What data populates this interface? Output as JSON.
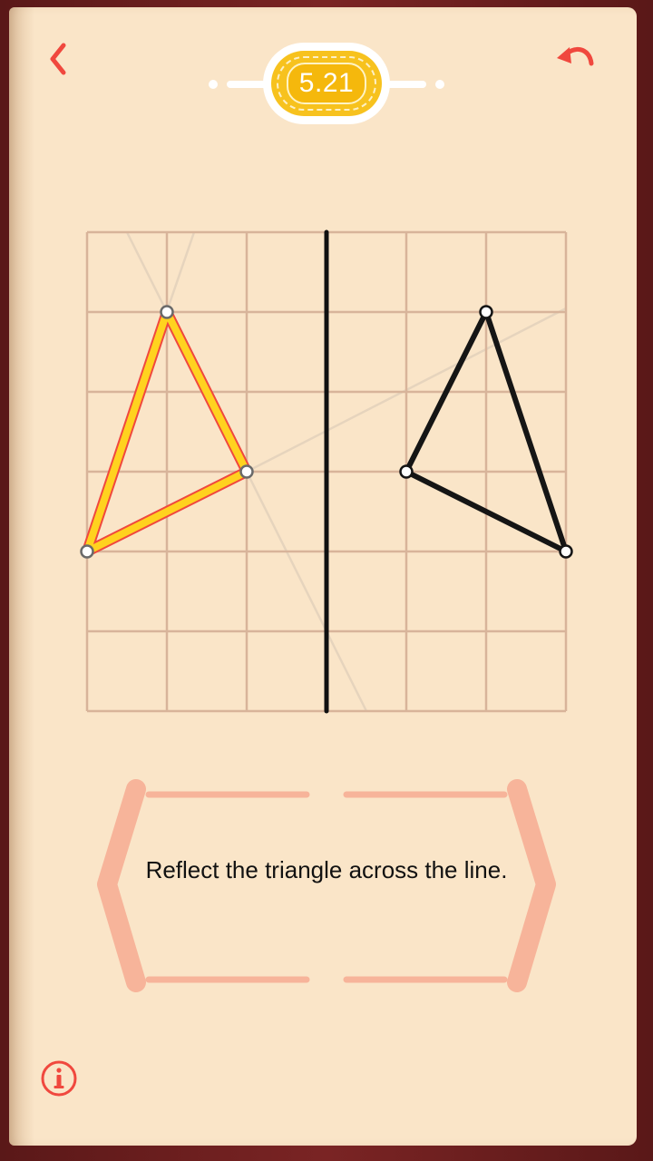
{
  "header": {
    "level": "5.21",
    "back_icon": "chevron-left-icon",
    "undo_icon": "undo-arrow-icon"
  },
  "puzzle": {
    "grid": {
      "columns": 6,
      "rows": 6
    },
    "mirror_line": {
      "orientation": "vertical",
      "column": 3
    },
    "source_triangle": [
      [
        1,
        1
      ],
      [
        2,
        3
      ],
      [
        0,
        4
      ]
    ],
    "reflected_triangle": [
      [
        5,
        1
      ],
      [
        4,
        3
      ],
      [
        6,
        4
      ]
    ],
    "colors": {
      "grid": "#d8b49a",
      "triangle_fill_stroke": "#ffd21f",
      "triangle_outline": "#f0483e",
      "answer_stroke": "#151515",
      "mirror": "#111111",
      "guide": "#e6d4bd"
    }
  },
  "instruction": {
    "text": "Reflect the triangle across the line."
  },
  "footer": {
    "info_icon": "info-icon"
  },
  "colors": {
    "accent": "#f0483e",
    "page": "#fae5c8",
    "bracket": "#f7b49a",
    "badge": "#f7c21e"
  }
}
